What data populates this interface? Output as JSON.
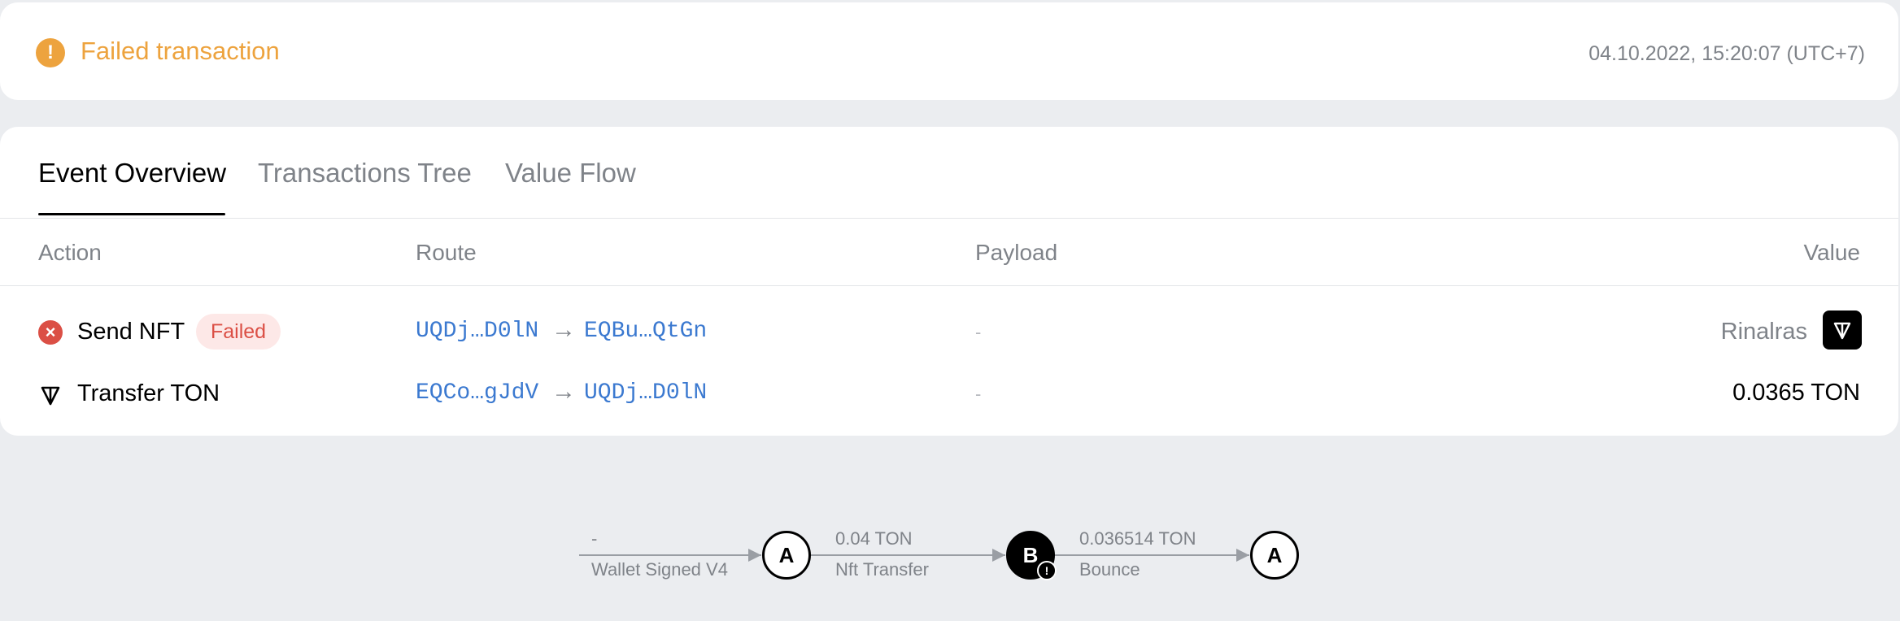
{
  "status": {
    "title": "Failed transaction",
    "icon": "warning-icon",
    "timestamp": "04.10.2022, 15:20:07 (UTC+7)"
  },
  "tabs": [
    {
      "label": "Event Overview",
      "active": true
    },
    {
      "label": "Transactions Tree",
      "active": false
    },
    {
      "label": "Value Flow",
      "active": false
    }
  ],
  "table": {
    "columns": [
      "Action",
      "Route",
      "Payload",
      "Value"
    ],
    "rows": [
      {
        "icon": "error-icon",
        "action": "Send NFT",
        "badge": "Failed",
        "from": "UQDj…D0lN",
        "to": "EQBu…QtGn",
        "payload": "-",
        "value": "Rinalras"
      },
      {
        "icon": "ton-icon",
        "action": "Transfer TON",
        "from": "EQCo…gJdV",
        "to": "UQDj…D0lN",
        "payload": "-",
        "value": "0.0365 TON"
      }
    ]
  },
  "flow": {
    "edges": [
      {
        "top": "-",
        "bottom": "Wallet Signed V4"
      },
      {
        "top": "0.04 TON",
        "bottom": "Nft Transfer"
      },
      {
        "top": "0.036514 TON",
        "bottom": "Bounce"
      }
    ],
    "nodes": [
      {
        "label": "A",
        "style": "outline"
      },
      {
        "label": "B",
        "style": "filled",
        "warning": "!"
      },
      {
        "label": "A",
        "style": "outline"
      }
    ]
  },
  "colors": {
    "warning": "#eda33e",
    "error": "#db4f45",
    "link": "#3b79d0",
    "muted": "#7f8389",
    "background": "#ebedf0"
  }
}
